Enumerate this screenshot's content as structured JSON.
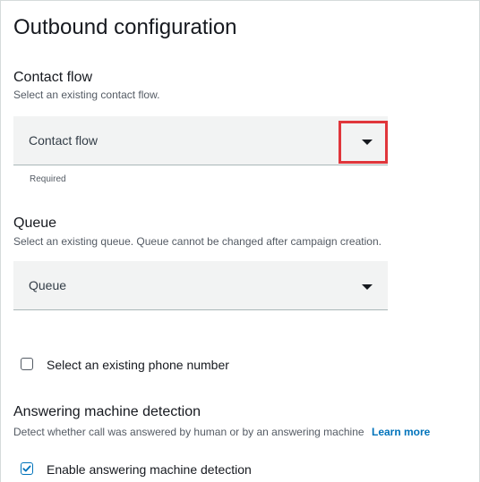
{
  "header": {
    "title": "Outbound configuration"
  },
  "contact_flow": {
    "label": "Contact flow",
    "description": "Select an existing contact flow.",
    "placeholder": "Contact flow",
    "hint": "Required"
  },
  "queue": {
    "label": "Queue",
    "description": "Select an existing queue. Queue cannot be changed after campaign creation.",
    "placeholder": "Queue"
  },
  "phone_number": {
    "label": "Select an existing phone number",
    "checked": false
  },
  "answering_machine": {
    "label": "Answering machine detection",
    "description": "Detect whether call was answered by human or by an answering machine",
    "learn_more": "Learn more",
    "enable_label": "Enable answering machine detection",
    "enabled": true
  },
  "colors": {
    "highlight": "#e0363b",
    "accent": "#0073bb",
    "field_background": "#f2f3f3"
  },
  "icons": {
    "dropdown": "caret-down-icon",
    "checkmark": "checkmark-icon"
  }
}
